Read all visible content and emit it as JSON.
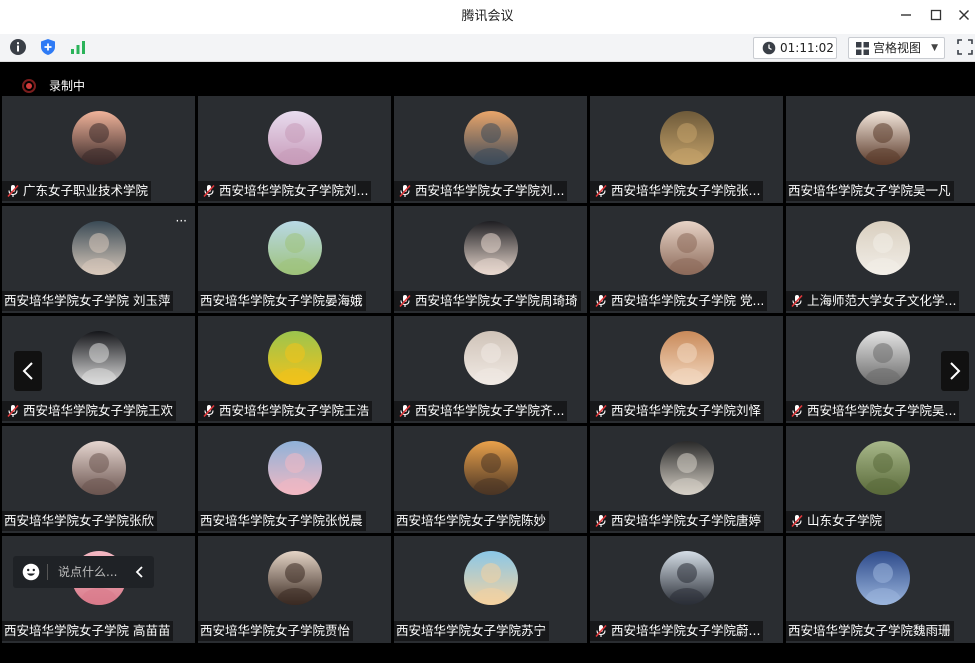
{
  "window": {
    "title": "腾讯会议",
    "minimize_label": "—",
    "maximize_label": "☐",
    "close_label": "✕"
  },
  "toolbar": {
    "timer": "01:11:02",
    "view_label": "宫格视图"
  },
  "recording": {
    "label": "录制中"
  },
  "chat": {
    "placeholder": "说点什么..."
  },
  "participants": [
    {
      "name": "广东女子职业技术学院",
      "mic_off": true,
      "avatar": "cartoon-girl",
      "colors": [
        "#f0b39a",
        "#3a2a2a"
      ]
    },
    {
      "name": "西安培华学院女子学院刘...",
      "mic_off": true,
      "avatar": "bunny",
      "colors": [
        "#e8dcef",
        "#c79ab8"
      ]
    },
    {
      "name": "西安培华学院女子学院刘...",
      "mic_off": true,
      "avatar": "sunset-silhouette",
      "colors": [
        "#e9a56a",
        "#3c4a5a"
      ]
    },
    {
      "name": "西安培华学院女子学院张...",
      "mic_off": true,
      "avatar": "hedgehog",
      "colors": [
        "#6e5a3a",
        "#c4a26a"
      ]
    },
    {
      "name": "西安培华学院女子学院吴一凡",
      "mic_off": false,
      "avatar": "anime-girl",
      "colors": [
        "#f4e7dc",
        "#5a3a2a"
      ]
    },
    {
      "name": "西安培华学院女子学院 刘玉萍",
      "mic_off": false,
      "avatar": "woman-hand",
      "colors": [
        "#3a4a55",
        "#d8c9bb"
      ],
      "more": "···"
    },
    {
      "name": "西安培华学院女子学院晏海娥",
      "mic_off": false,
      "avatar": "girl-field",
      "colors": [
        "#b9d9e6",
        "#9ec27a"
      ]
    },
    {
      "name": "西安培华学院女子学院周琦琦",
      "mic_off": true,
      "avatar": "girl-dark",
      "colors": [
        "#1e1e22",
        "#e9d9cf"
      ]
    },
    {
      "name": "西安培华学院女子学院  党...",
      "mic_off": true,
      "avatar": "girl-soft",
      "colors": [
        "#e7d3c6",
        "#8c6a5a"
      ]
    },
    {
      "name": "上海师范大学女子文化学...",
      "mic_off": true,
      "avatar": "white-horse",
      "colors": [
        "#d9cfbf",
        "#f2eee8"
      ]
    },
    {
      "name": "西安培华学院女子学院王欢",
      "mic_off": true,
      "avatar": "boy-dark",
      "colors": [
        "#15161a",
        "#dcdcdc"
      ]
    },
    {
      "name": "西安培华学院女子学院王浩",
      "mic_off": true,
      "avatar": "sunflower",
      "colors": [
        "#9bc44e",
        "#f2c21a"
      ]
    },
    {
      "name": "西安培华学院女子学院齐...",
      "mic_off": true,
      "avatar": "girl-hat",
      "colors": [
        "#cfc3b8",
        "#f1eae4"
      ]
    },
    {
      "name": "西安培华学院女子学院刘怿",
      "mic_off": true,
      "avatar": "cartoon-boy",
      "colors": [
        "#c98a5a",
        "#f3d9c1"
      ]
    },
    {
      "name": "西安培华学院女子学院吴...",
      "mic_off": true,
      "avatar": "chef-cartoon",
      "colors": [
        "#e4e4e4",
        "#6b6b6b"
      ]
    },
    {
      "name": "西安培华学院女子学院张欣",
      "mic_off": false,
      "avatar": "sketch-woman",
      "colors": [
        "#e6d6d0",
        "#6b5550"
      ]
    },
    {
      "name": "西安培华学院女子学院张悦晨",
      "mic_off": false,
      "avatar": "pig-balloon",
      "colors": [
        "#8fb2d9",
        "#f2b8c2"
      ]
    },
    {
      "name": "西安培华学院女子学院陈妙",
      "mic_off": false,
      "avatar": "sunset-girl",
      "colors": [
        "#e9a14b",
        "#4a3525"
      ]
    },
    {
      "name": "西安培华学院女子学院唐婷",
      "mic_off": true,
      "avatar": "masked-boy",
      "colors": [
        "#2a2a2a",
        "#d6d0c6"
      ]
    },
    {
      "name": "山东女子学院",
      "mic_off": true,
      "avatar": "grass",
      "colors": [
        "#a8b88a",
        "#5a6a3a"
      ]
    },
    {
      "name": "西安培华学院女子学院 高苗苗",
      "mic_off": false,
      "avatar": "pink-girl",
      "colors": [
        "#f4b9c4",
        "#d97a8a"
      ]
    },
    {
      "name": "西安培华学院女子学院贾怡",
      "mic_off": false,
      "avatar": "long-hair-girl",
      "colors": [
        "#e4d4c6",
        "#3a2a22"
      ]
    },
    {
      "name": "西安培华学院女子学院苏宁",
      "mic_off": false,
      "avatar": "anime-face",
      "colors": [
        "#8ac7e8",
        "#f4d2a0"
      ]
    },
    {
      "name": "西安培华学院女子学院蔚...",
      "mic_off": true,
      "avatar": "girl-night",
      "colors": [
        "#d4dde6",
        "#2a2e36"
      ]
    },
    {
      "name": "西安培华学院女子学院魏雨珊",
      "mic_off": false,
      "avatar": "blue-sky",
      "colors": [
        "#2d4a8a",
        "#9ab4dc"
      ]
    }
  ]
}
